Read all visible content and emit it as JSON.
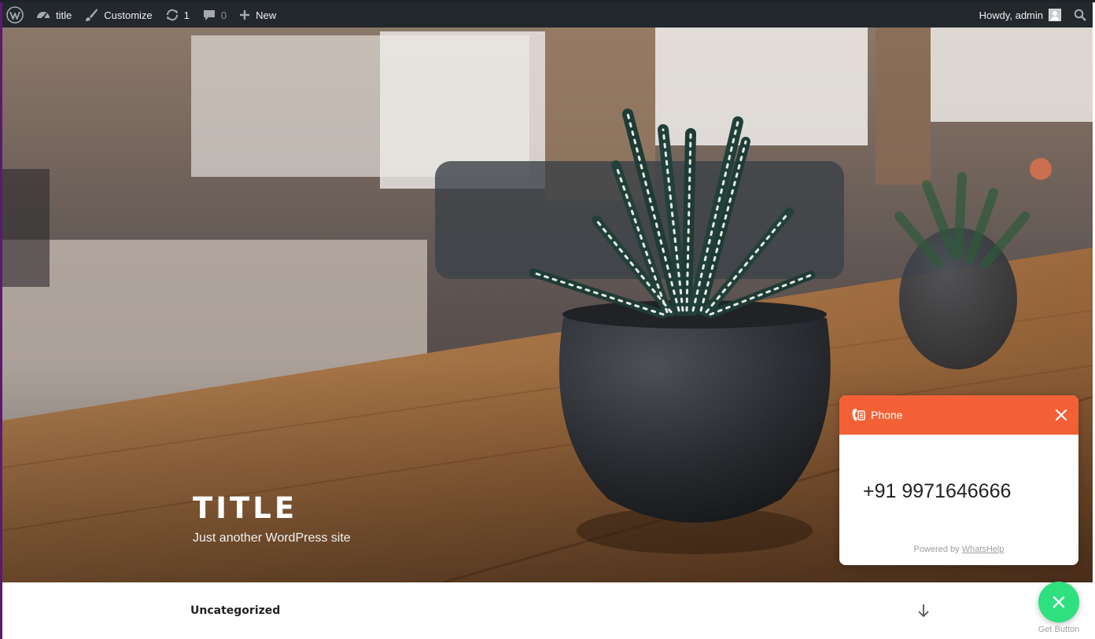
{
  "adminbar": {
    "site_name": "title",
    "customize": "Customize",
    "updates_count": "1",
    "comments_count": "0",
    "new_label": "New",
    "greeting": "Howdy, admin"
  },
  "hero": {
    "site_title": "TITLE",
    "tagline": "Just another WordPress site"
  },
  "navigation": {
    "category_link": "Uncategorized"
  },
  "whatshelp": {
    "header_label": "Phone",
    "phone_number": "+91 9971646666",
    "powered_prefix": "Powered by",
    "powered_link": "WhatsHelp",
    "button_caption": "Get Button",
    "accent_color": "#f46036",
    "button_color": "#2fe07e"
  },
  "icons": {
    "wordpress": "wordpress-logo-icon",
    "dashboard": "dashboard-icon",
    "customize": "paintbrush-icon",
    "updates": "refresh-icon",
    "comments": "comment-icon",
    "new": "plus-icon",
    "search": "search-icon"
  }
}
